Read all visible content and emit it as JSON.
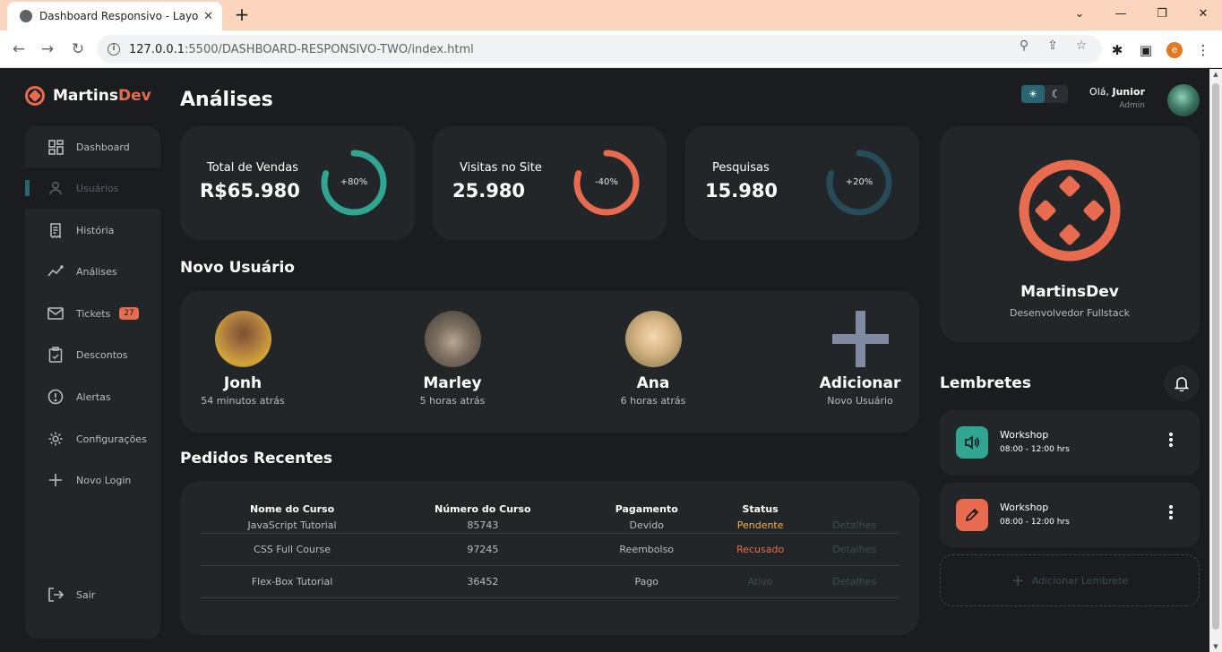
{
  "browser": {
    "tab_title": "Dashboard Responsivo - Layout",
    "url_host": "127.0.0.1",
    "url_path": ":5500/DASHBOARD-RESPONSIVO-TWO/index.html"
  },
  "brand": {
    "name_part1": "Martins",
    "name_part2": "Dev"
  },
  "sidebar": {
    "items": [
      {
        "label": "Dashboard",
        "icon": "grid-icon"
      },
      {
        "label": "Usuários",
        "icon": "user-icon"
      },
      {
        "label": "História",
        "icon": "receipt-icon"
      },
      {
        "label": "Análises",
        "icon": "analytics-icon"
      },
      {
        "label": "Tickets",
        "icon": "mail-icon",
        "badge": "27"
      },
      {
        "label": "Descontos",
        "icon": "clipboard-icon"
      },
      {
        "label": "Alertas",
        "icon": "alert-icon"
      },
      {
        "label": "Configurações",
        "icon": "gear-icon"
      },
      {
        "label": "Novo Login",
        "icon": "plus-icon"
      }
    ],
    "logout": "Sair"
  },
  "main": {
    "title": "Análises",
    "stats": [
      {
        "label": "Total de Vendas",
        "value": "R$65.980",
        "percent": "+80%",
        "progress": 0.8,
        "color": "#2fa592"
      },
      {
        "label": "Visitas no Site",
        "value": "25.980",
        "percent": "-40%",
        "progress": 0.8,
        "color": "#e86b4f"
      },
      {
        "label": "Pesquisas",
        "value": "15.980",
        "percent": "+20%",
        "progress": 0.8,
        "color": "#274b58"
      }
    ],
    "new_users_title": "Novo Usuário",
    "users": [
      {
        "name": "Jonh",
        "time": "54 minutos atrás"
      },
      {
        "name": "Marley",
        "time": "5 horas atrás"
      },
      {
        "name": "Ana",
        "time": "6 horas atrás"
      }
    ],
    "add_user": {
      "label": "Adicionar",
      "sub": "Novo Usuário"
    },
    "orders_title": "Pedidos Recentes",
    "orders": {
      "headers": [
        "Nome do Curso",
        "Número do Curso",
        "Pagamento",
        "Status",
        ""
      ],
      "rows": [
        {
          "course": "JavaScript Tutorial",
          "number": "85743",
          "payment": "Devido",
          "status": "Pendente",
          "details": "Detalhes"
        },
        {
          "course": "CSS Full Course",
          "number": "97245",
          "payment": "Reembolso",
          "status": "Recusado",
          "details": "Detalhes"
        },
        {
          "course": "Flex-Box Tutorial",
          "number": "36452",
          "payment": "Pago",
          "status": "Ativo",
          "details": "Detalhes"
        }
      ]
    }
  },
  "right": {
    "greeting": "Olá,",
    "user": "Junior",
    "role": "Admin",
    "profile": {
      "name": "MartinsDev",
      "subtitle": "Desenvolvedor Fullstack"
    },
    "reminders_title": "Lembretes",
    "reminders": [
      {
        "title": "Workshop",
        "time": "08:00 - 12:00 hrs",
        "icon": "volume-icon",
        "color": "#2fa592"
      },
      {
        "title": "Workshop",
        "time": "08:00 - 12:00 hrs",
        "icon": "pencil-icon",
        "color": "#e86b4f"
      }
    ],
    "add_reminder": "Adicionar Lembrete"
  },
  "colors": {
    "accent": "#e86b4f",
    "teal": "#2fa592",
    "background": "#1b1c1f",
    "card": "#232629"
  }
}
